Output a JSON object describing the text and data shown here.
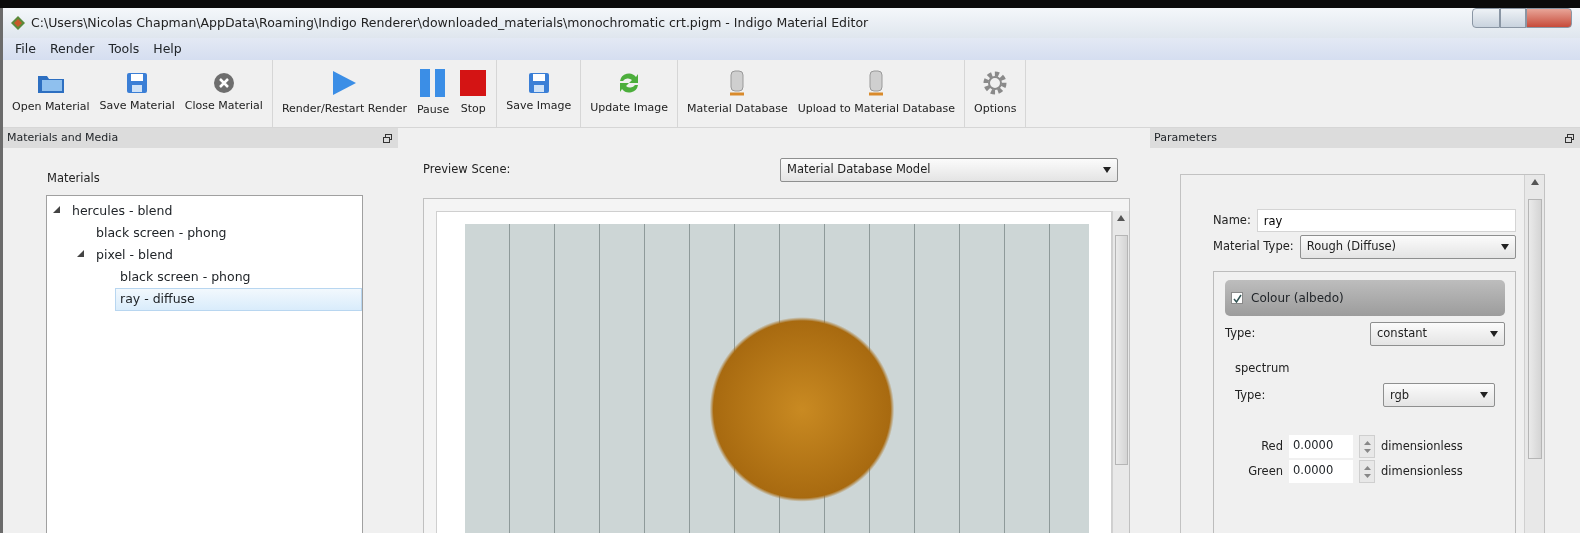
{
  "window": {
    "title": "C:\\Users\\Nicolas Chapman\\AppData\\Roaming\\Indigo Renderer\\downloaded_materials\\monochromatic crt.pigm - Indigo Material Editor"
  },
  "menu": [
    "File",
    "Render",
    "Tools",
    "Help"
  ],
  "toolbar": [
    [
      {
        "label": "Open Material",
        "kind": "folder"
      },
      {
        "label": "Save Material",
        "kind": "save"
      },
      {
        "label": "Close Material",
        "kind": "close"
      }
    ],
    [
      {
        "label": "Render/Restart Render",
        "kind": "play"
      },
      {
        "label": "Pause",
        "kind": "pause"
      },
      {
        "label": "Stop",
        "kind": "stop"
      }
    ],
    [
      {
        "label": "Save Image",
        "kind": "save"
      }
    ],
    [
      {
        "label": "Update Image",
        "kind": "refresh"
      }
    ],
    [
      {
        "label": "Material Database",
        "kind": "database"
      },
      {
        "label": "Upload to Material Database",
        "kind": "database"
      }
    ],
    [
      {
        "label": "Options",
        "kind": "gear"
      }
    ]
  ],
  "left_panel": {
    "title": "Materials and Media",
    "materials_label": "Materials",
    "tree": [
      {
        "label": "hercules - blend",
        "expanded": true,
        "selected": false,
        "children": [
          {
            "label": "black screen - phong",
            "selected": false
          },
          {
            "label": "pixel - blend",
            "expanded": true,
            "selected": false,
            "children": [
              {
                "label": "black screen - phong",
                "selected": false
              },
              {
                "label": "ray - diffuse",
                "selected": true
              }
            ]
          }
        ]
      }
    ]
  },
  "preview": {
    "scene_label": "Preview Scene:",
    "scene_value": "Material Database Model"
  },
  "parameters": {
    "title": "Parameters",
    "name_label": "Name:",
    "name_value": "ray",
    "material_type_label": "Material Type:",
    "material_type_value": "Rough (Diffuse)",
    "colour": {
      "label": "Colour (albedo)",
      "checked": true
    },
    "type_label": "Type:",
    "type_value": "constant",
    "spectrum_label": "spectrum",
    "spectrum_type_label": "Type:",
    "spectrum_type_value": "rgb",
    "channels": [
      {
        "label": "Red",
        "value": "0.0000",
        "unit": "dimensionless"
      },
      {
        "label": "Green",
        "value": "0.0000",
        "unit": "dimensionless"
      }
    ]
  }
}
